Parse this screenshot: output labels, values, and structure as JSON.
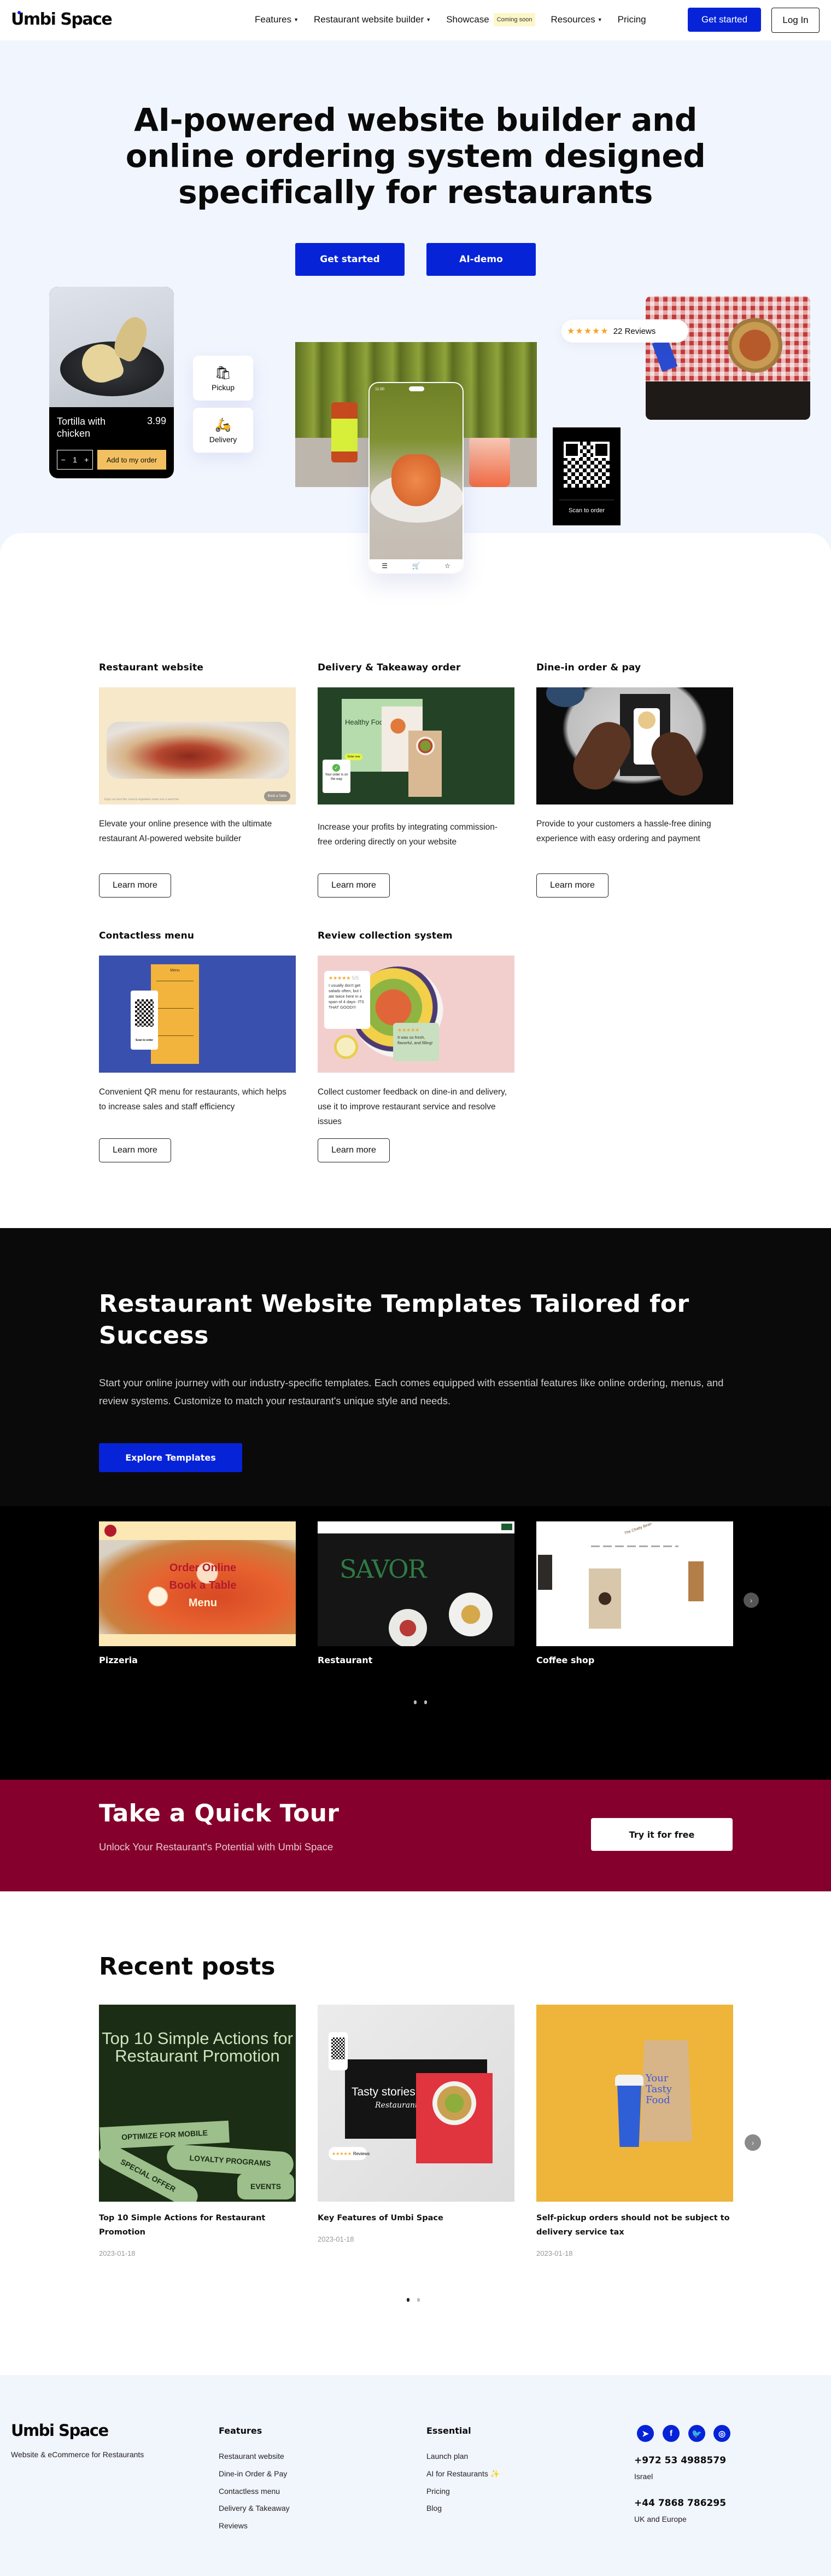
{
  "nav": {
    "logo": "Umbi Space",
    "links": [
      {
        "label": "Features",
        "dropdown": true
      },
      {
        "label": "Restaurant website builder",
        "dropdown": true
      },
      {
        "label": "Showcase",
        "dropdown": false,
        "badge": "Coming soon"
      },
      {
        "label": "Resources",
        "dropdown": true
      },
      {
        "label": "Pricing",
        "dropdown": false
      }
    ],
    "get_started": "Get started",
    "login": "Log In"
  },
  "hero": {
    "title_lines": [
      "AI-powered website builder and",
      "online ordering system designed",
      "specifically for restaurants"
    ],
    "btn_primary": "Get started",
    "btn_secondary": "AI-demo",
    "product_card": {
      "name": "Tortilla with chicken",
      "price": "3.99",
      "qty": "1",
      "minus": "−",
      "plus": "+",
      "add_label": "Add to my order"
    },
    "pickup_label": "Pickup",
    "delivery_label": "Delivery",
    "reviews": {
      "stars": "★★★★★",
      "label": "22 Reviews"
    },
    "qr_caption": "Scan to order",
    "phone_time": "11:00"
  },
  "features": [
    {
      "title": "Restaurant website",
      "desc": "Elevate your online presence with the ultimate restaurant AI-powered website builder",
      "button": "Learn more",
      "image_text": "Book a Table"
    },
    {
      "title": "Delivery & Takeaway order",
      "desc": "Increase your profits by integrating commission-free ordering directly on your website",
      "button": "Learn more",
      "image_text": [
        "Healthy Food Delivery",
        "Order now",
        "Your order is on the way"
      ]
    },
    {
      "title": "Dine-in order & pay",
      "desc": "Provide to your customers a hassle-free dining experience with easy ordering and payment",
      "button": "Learn more"
    },
    {
      "title": "Contactless menu",
      "desc": "Convenient QR menu for restaurants, which helps to increase sales and staff efficiency",
      "button": "Learn more",
      "image_text": [
        "Menu",
        "Scan to order"
      ]
    },
    {
      "title": "Review collection system",
      "desc": "Collect customer feedback on dine-in and delivery, use it to improve restaurant service and resolve issues",
      "button": "Learn more",
      "image_text": [
        "5/5",
        "I usually don't get salads often, but I ate twice here in a span of 4 days- ITS THAT GOOD!!!",
        "It was so fresh, flavorful, and filling!"
      ]
    }
  ],
  "templates": {
    "title": "Restaurant Website Templates Tailored for Success",
    "desc": "Start your online journey with our industry-specific templates. Each comes equipped with essential features like online ordering, menus, and review systems. Customize to match your restaurant's unique style and needs.",
    "button": "Explore Templates",
    "cards": [
      {
        "label": "Pizzeria",
        "image_text": [
          "Order Online",
          "Book a Table",
          "Menu"
        ]
      },
      {
        "label": "Restaurant",
        "image_text": [
          "SAVOR"
        ]
      },
      {
        "label": "Coffee shop",
        "image_text": [
          "The Chatty Bean"
        ]
      }
    ],
    "next": "›"
  },
  "tour": {
    "title": "Take a Quick Tour",
    "subtitle": "Unlock Your Restaurant's Potential with Umbi Space",
    "button": "Try it for free"
  },
  "posts": {
    "title": "Recent posts",
    "items": [
      {
        "title": "Top 10 Simple Actions for Restaurant Promotion",
        "date": "2023-01-18",
        "image_text": [
          "Top 10 Simple Actions for Restaurant Promotion",
          "OPTIMIZE FOR MOBILE",
          "LOYALTY PROGRAMS",
          "SPECIAL OFFER",
          "EVENTS"
        ]
      },
      {
        "title": "Key Features of Umbi Space",
        "date": "2023-01-18",
        "image_text": [
          "Tasty stories",
          "Restaurant",
          "Reviews"
        ]
      },
      {
        "title": "Self-pickup orders should not be subject to delivery service tax",
        "date": "2023-01-18",
        "image_text": [
          "Your Tasty Food"
        ]
      }
    ],
    "next": "›"
  },
  "footer": {
    "logo": "Umbi Space",
    "tagline": "Website & eCommerce for Restaurants",
    "features_heading": "Features",
    "features_links": [
      "Restaurant website",
      "Dine-in Order & Pay",
      "Contactless menu",
      "Delivery & Takeaway",
      "Reviews"
    ],
    "essential_heading": "Essential",
    "essential_links": [
      "Launch plan",
      "AI for Restaurants ✨",
      "Pricing",
      "Blog"
    ],
    "social": [
      "telegram",
      "facebook",
      "twitter",
      "instagram"
    ],
    "contacts": [
      {
        "phone": "+972 53 4988579",
        "region": "Israel"
      },
      {
        "phone": "+44 7868 786295",
        "region": "UK and Europe"
      }
    ]
  },
  "colors": {
    "brand_blue": "#0723d8",
    "tour_bg": "#85002c",
    "hero_bg": "#f1f5fe"
  }
}
